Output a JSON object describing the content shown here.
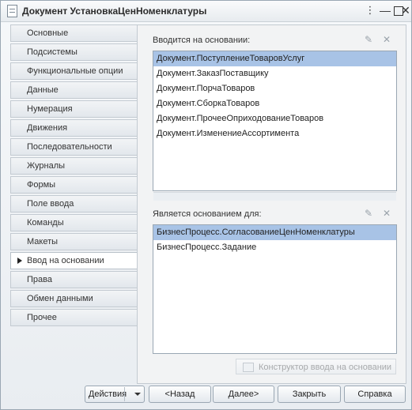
{
  "window": {
    "title": "Документ УстановкаЦенНоменклатуры"
  },
  "tabs": [
    {
      "label": "Основные"
    },
    {
      "label": "Подсистемы"
    },
    {
      "label": "Функциональные опции"
    },
    {
      "label": "Данные"
    },
    {
      "label": "Нумерация"
    },
    {
      "label": "Движения"
    },
    {
      "label": "Последовательности"
    },
    {
      "label": "Журналы"
    },
    {
      "label": "Формы"
    },
    {
      "label": "Поле ввода"
    },
    {
      "label": "Команды"
    },
    {
      "label": "Макеты"
    },
    {
      "label": "Ввод на основании",
      "active": true
    },
    {
      "label": "Права"
    },
    {
      "label": "Обмен данными"
    },
    {
      "label": "Прочее"
    }
  ],
  "based_on": {
    "label": "Вводится на основании:",
    "items": [
      "Документ.ПоступлениеТоваровУслуг",
      "Документ.ЗаказПоставщику",
      "Документ.ПорчаТоваров",
      "Документ.СборкаТоваров",
      "Документ.ПрочееОприходованиеТоваров",
      "Документ.ИзменениеАссортимента"
    ],
    "selected_index": 0
  },
  "basis_for": {
    "label": "Является основанием для:",
    "items": [
      "БизнесПроцесс.СогласованиеЦенНоменклатуры",
      "БизнесПроцесс.Задание"
    ],
    "selected_index": 0
  },
  "constructor_button": {
    "label": "Конструктор ввода на основании"
  },
  "bottom": {
    "actions": "Действия",
    "back": "<Назад",
    "next": "Далее>",
    "close": "Закрыть",
    "help": "Справка"
  },
  "colors": {
    "selection": "#a8c3e6",
    "border": "#9aa7b3"
  }
}
